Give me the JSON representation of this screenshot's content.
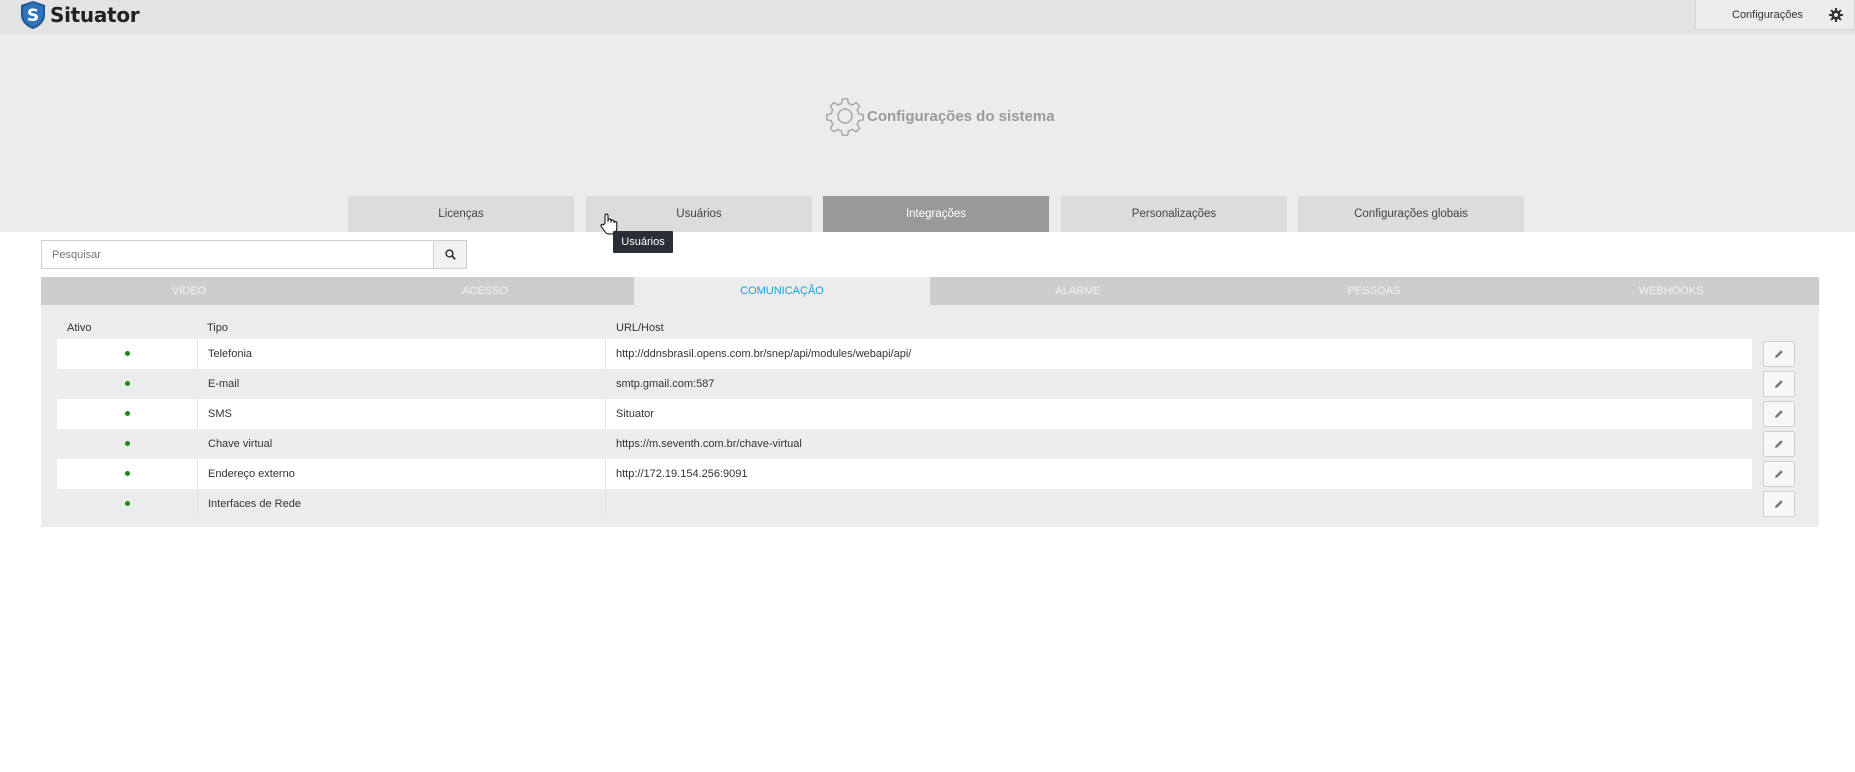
{
  "app": {
    "name": "Situator",
    "logo_letter": "S"
  },
  "topbar": {
    "config_label": "Configurações"
  },
  "page": {
    "title": "Configurações do sistema"
  },
  "main_tabs": [
    {
      "label": "Licenças",
      "active": false
    },
    {
      "label": "Usuários",
      "active": false
    },
    {
      "label": "Integrações",
      "active": true
    },
    {
      "label": "Personalizações",
      "active": false
    },
    {
      "label": "Configurações globais",
      "active": false
    }
  ],
  "tooltip": {
    "text": "Usuários"
  },
  "search": {
    "placeholder": "Pesquisar",
    "value": ""
  },
  "sub_tabs": [
    {
      "label": "VÍDEO",
      "active": false
    },
    {
      "label": "ACESSO",
      "active": false
    },
    {
      "label": "COMUNICAÇÃO",
      "active": true
    },
    {
      "label": "ALARME",
      "active": false
    },
    {
      "label": "PESSOAS",
      "active": false
    },
    {
      "label": "WEBHOOKS",
      "active": false
    }
  ],
  "table": {
    "headers": {
      "active": "Ativo",
      "type": "Tipo",
      "url": "URL/Host"
    },
    "rows": [
      {
        "active": true,
        "type": "Telefonia",
        "url": "http://ddnsbrasil.opens.com.br/snep/api/modules/webapi/api/"
      },
      {
        "active": true,
        "type": "E-mail",
        "url": "smtp.gmail.com:587"
      },
      {
        "active": true,
        "type": "SMS",
        "url": "Situator"
      },
      {
        "active": true,
        "type": "Chave virtual",
        "url": "https://m.seventh.com.br/chave-virtual"
      },
      {
        "active": true,
        "type": "Endereço externo",
        "url": "http://172.19.154.256:9091"
      },
      {
        "active": true,
        "type": "Interfaces de Rede",
        "url": ""
      }
    ]
  },
  "colors": {
    "accent": "#1aa1dc",
    "active_dot": "#1a8a1a",
    "active_main_tab": "#999999",
    "logo_shield": "#1f5a96"
  }
}
